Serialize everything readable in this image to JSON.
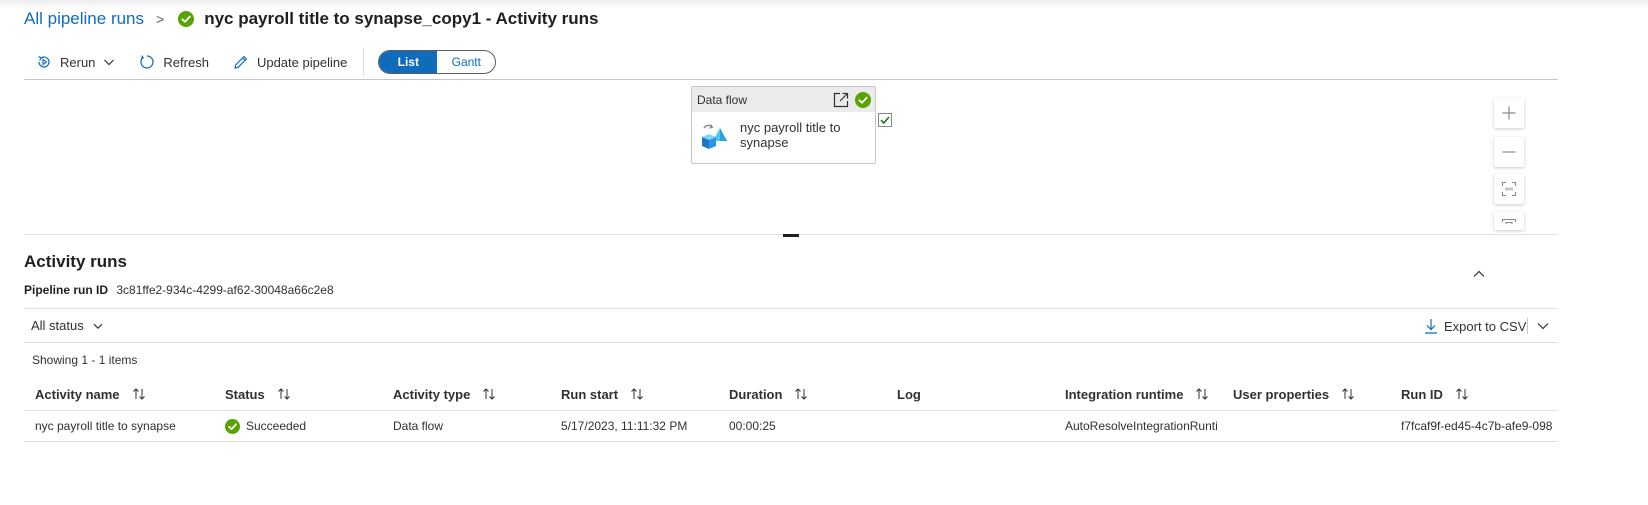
{
  "breadcrumb": {
    "root": "All pipeline runs",
    "separator": ">",
    "title": "nyc payroll title to synapse_copy1 - Activity runs"
  },
  "toolbar": {
    "rerun": "Rerun",
    "refresh": "Refresh",
    "update_pipeline": "Update pipeline",
    "view_toggle": {
      "list": "List",
      "gantt": "Gantt",
      "selected": "List"
    }
  },
  "canvas": {
    "node": {
      "type": "Data flow",
      "name": "nyc payroll title to synapse",
      "status": "succeeded"
    },
    "zoom_controls": [
      "zoom-in",
      "zoom-out",
      "zoom-100",
      "fit-to-screen"
    ]
  },
  "activity_runs": {
    "title": "Activity runs",
    "pipeline_run_id_label": "Pipeline run ID",
    "pipeline_run_id": "3c81ffe2-934c-4299-af62-30048a66c2e8",
    "status_filter": "All status",
    "export": "Export to CSV",
    "showing": "Showing 1 - 1 items",
    "columns": [
      "Activity name",
      "Status",
      "Activity type",
      "Run start",
      "Duration",
      "Log",
      "Integration runtime",
      "User properties",
      "Run ID"
    ],
    "rows": [
      {
        "activity_name": "nyc payroll title to synapse",
        "status": "Succeeded",
        "activity_type": "Data flow",
        "run_start": "5/17/2023, 11:11:32 PM",
        "duration": "00:00:25",
        "log": "",
        "integration_runtime": "AutoResolveIntegrationRunti",
        "user_properties": "",
        "run_id": "f7fcaf9f-ed45-4c7b-afe9-098"
      }
    ]
  },
  "colors": {
    "accent": "#0f6cbd",
    "success": "#57a300",
    "border": "#e1dfdd"
  }
}
